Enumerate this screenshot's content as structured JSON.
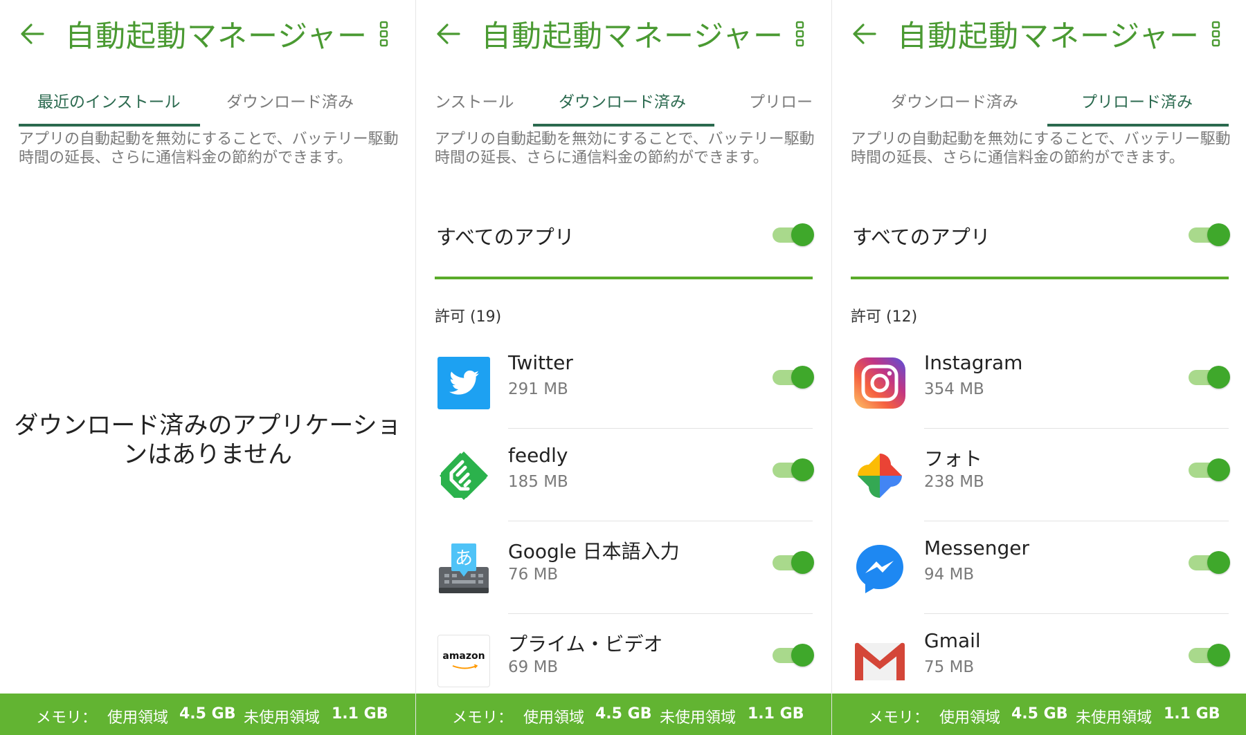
{
  "colors": {
    "accent": "#4a9a32",
    "tab_active": "#2b6a4f",
    "switch_on": "#3fa82b",
    "footer_bg": "#62b432"
  },
  "panels": [
    {
      "title": "自動起動マネージャー",
      "tabs": [
        "最近のインストール",
        "ダウンロード済み"
      ],
      "active_tab": 0,
      "description": "アプリの自動起動を無効にすることで、バッテリー駆動時間の延長、さらに通信料金の節約ができます。",
      "empty_message_line1": "ダウンロード済みのアプリケーショ",
      "empty_message_line2": "ンはありません",
      "footer": {
        "memory_label": "メモリ：",
        "used_label": "使用領域",
        "used_value": "4.5 GB",
        "free_label": "未使用領域",
        "free_value": "1.1 GB"
      }
    },
    {
      "title": "自動起動マネージャー",
      "tabs": [
        "ンストール",
        "ダウンロード済み",
        "プリロー"
      ],
      "active_tab": 1,
      "description": "アプリの自動起動を無効にすることで、バッテリー駆動時間の延長、さらに通信料金の節約ができます。",
      "all_apps_label": "すべてのアプリ",
      "all_apps_enabled": true,
      "section_label": "許可 (19)",
      "apps": [
        {
          "name": "Twitter",
          "size": "291 MB",
          "icon": "twitter-icon",
          "enabled": true
        },
        {
          "name": "feedly",
          "size": "185 MB",
          "icon": "feedly-icon",
          "enabled": true
        },
        {
          "name": "Google 日本語入力",
          "size": "76 MB",
          "icon": "google-japanese-input-icon",
          "enabled": true
        },
        {
          "name": "プライム・ビデオ",
          "size": "69 MB",
          "icon": "amazon-prime-video-icon",
          "enabled": true,
          "icon_text": "amazon"
        }
      ],
      "footer": {
        "memory_label": "メモリ：",
        "used_label": "使用領域",
        "used_value": "4.5 GB",
        "free_label": "未使用領域",
        "free_value": "1.1 GB"
      }
    },
    {
      "title": "自動起動マネージャー",
      "tabs": [
        "ダウンロード済み",
        "プリロード済み"
      ],
      "active_tab": 1,
      "description": "アプリの自動起動を無効にすることで、バッテリー駆動時間の延長、さらに通信料金の節約ができます。",
      "all_apps_label": "すべてのアプリ",
      "all_apps_enabled": true,
      "section_label": "許可 (12)",
      "apps": [
        {
          "name": "Instagram",
          "size": "354 MB",
          "icon": "instagram-icon",
          "enabled": true
        },
        {
          "name": "フォト",
          "size": "238 MB",
          "icon": "google-photos-icon",
          "enabled": true
        },
        {
          "name": "Messenger",
          "size": "94 MB",
          "icon": "messenger-icon",
          "enabled": true
        },
        {
          "name": "Gmail",
          "size": "75 MB",
          "icon": "gmail-icon",
          "enabled": true
        }
      ],
      "footer": {
        "memory_label": "メモリ：",
        "used_label": "使用領域",
        "used_value": "4.5 GB",
        "free_label": "未使用領域",
        "free_value": "1.1 GB"
      }
    }
  ]
}
